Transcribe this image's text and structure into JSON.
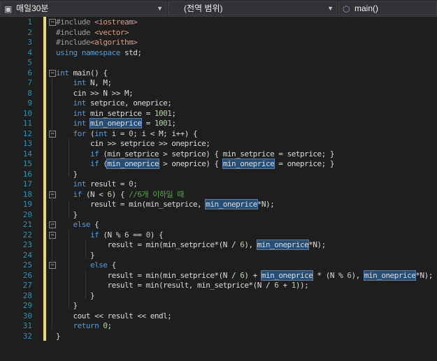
{
  "navbar": {
    "file_dropdown": "매일30분",
    "scope_dropdown": "(전역 범위)",
    "function_dropdown": "main()"
  },
  "editor": {
    "lines": [
      {
        "n": "1",
        "fold": "-",
        "html": "<span class='pp'>#include</span> <span class='inc'>&lt;iostream&gt;</span>"
      },
      {
        "n": "2",
        "fold": "",
        "html": "<span class='pp'>#include</span> <span class='inc'>&lt;vector&gt;</span>"
      },
      {
        "n": "3",
        "fold": "",
        "html": "<span class='pp'>#include</span><span class='inc'>&lt;algorithm&gt;</span>"
      },
      {
        "n": "4",
        "fold": "",
        "html": "<span class='kw'>using namespace</span> std;"
      },
      {
        "n": "5",
        "fold": "",
        "html": ""
      },
      {
        "n": "6",
        "fold": "-",
        "html": "<span class='kw'>int</span> main() {"
      },
      {
        "n": "7",
        "fold": "",
        "html": "    <span class='kw'>int</span> N, M;"
      },
      {
        "n": "8",
        "fold": "",
        "html": "    cin &gt;&gt; N &gt;&gt; M;"
      },
      {
        "n": "9",
        "fold": "",
        "html": "    <span class='kw'>int</span> setprice, oneprice;"
      },
      {
        "n": "10",
        "fold": "",
        "html": "    <span class='kw'>int</span> min_setprice = <span class='num'>1001</span>;"
      },
      {
        "n": "11",
        "fold": "",
        "html": "    <span class='kw'>int</span> <span class='hl'>min_oneprice</span> = <span class='num'>1001</span>;"
      },
      {
        "n": "12",
        "fold": "-",
        "html": "    <span class='kw'>for</span> (<span class='kw'>int</span> i = <span class='num'>0</span>; i &lt; M; i++) {"
      },
      {
        "n": "13",
        "fold": "",
        "html": "        cin &gt;&gt; setprice &gt;&gt; oneprice;"
      },
      {
        "n": "14",
        "fold": "",
        "html": "        <span class='kw'>if</span> (min_setprice &gt; setprice) { min_setprice = setprice; }"
      },
      {
        "n": "15",
        "fold": "",
        "html": "        <span class='kw'>if</span> (<span class='hl'>min_oneprice</span> &gt; oneprice) { <span class='hl'>min_oneprice</span> = oneprice; }"
      },
      {
        "n": "16",
        "fold": "",
        "html": "    }"
      },
      {
        "n": "17",
        "fold": "",
        "html": "    <span class='kw'>int</span> result = <span class='num'>0</span>;"
      },
      {
        "n": "18",
        "fold": "-",
        "html": "    <span class='kw'>if</span> (N &lt; <span class='num'>6</span>) { <span class='cm'>//6개 이하일 때</span>"
      },
      {
        "n": "19",
        "fold": "",
        "html": "        result = min(min_setprice, <span class='hl'>min_oneprice</span>*N);"
      },
      {
        "n": "20",
        "fold": "",
        "html": "    }"
      },
      {
        "n": "21",
        "fold": "-",
        "html": "    <span class='kw'>else</span> {"
      },
      {
        "n": "22",
        "fold": "-",
        "html": "        <span class='kw'>if</span> (N % <span class='num'>6</span> == <span class='num'>0</span>) {"
      },
      {
        "n": "23",
        "fold": "",
        "html": "            result = min(min_setprice*(N / <span class='num'>6</span>), <span class='hl'>min_oneprice</span>*N);"
      },
      {
        "n": "24",
        "fold": "",
        "html": "        }"
      },
      {
        "n": "25",
        "fold": "-",
        "html": "        <span class='kw'>else</span> {"
      },
      {
        "n": "26",
        "fold": "",
        "html": "            result = min(min_setprice*(N / <span class='num'>6</span>) + <span class='hl'>min_oneprice</span> * (N % <span class='num'>6</span>), <span class='hl'>min_oneprice</span>*N);"
      },
      {
        "n": "27",
        "fold": "",
        "html": "            result = min(result, min_setprice*(N / <span class='num'>6</span> + <span class='num'>1</span>));"
      },
      {
        "n": "28",
        "fold": "",
        "html": "        }"
      },
      {
        "n": "29",
        "fold": "",
        "html": "    }"
      },
      {
        "n": "30",
        "fold": "",
        "html": "    cout &lt;&lt; result &lt;&lt; endl;"
      },
      {
        "n": "31",
        "fold": "",
        "html": "    <span class='kw'>return</span> <span class='num'>0</span>;"
      },
      {
        "n": "32",
        "fold": "",
        "html": "}"
      }
    ]
  }
}
